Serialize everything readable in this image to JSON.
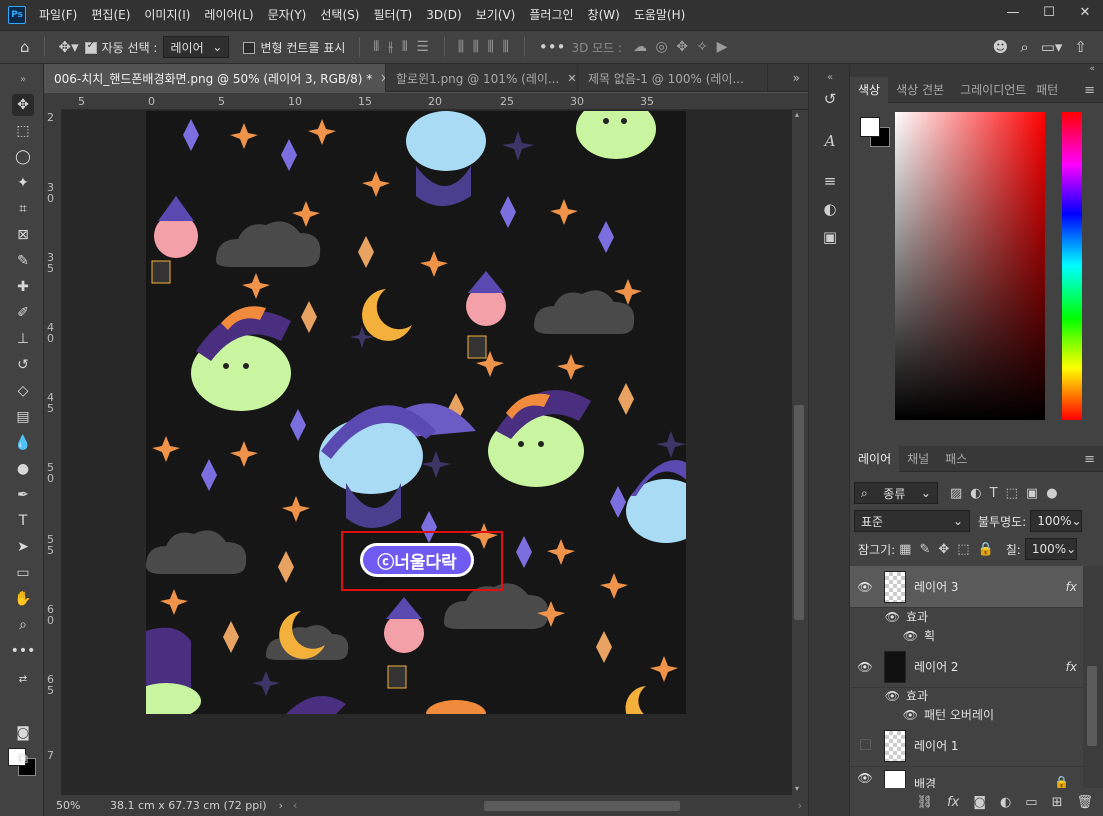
{
  "menubar": {
    "logo": "Ps",
    "items": [
      "파일(F)",
      "편집(E)",
      "이미지(I)",
      "레이어(L)",
      "문자(Y)",
      "선택(S)",
      "필터(T)",
      "3D(D)",
      "보기(V)",
      "플러그인",
      "창(W)",
      "도움말(H)"
    ],
    "minimize": "—",
    "maximize": "☐",
    "close": "✕"
  },
  "options": {
    "auto_select_label": "자동 선택 :",
    "auto_select_value": "레이어",
    "transform_controls_label": "변형 컨트롤 표시",
    "mode_3d_label": "3D 모드 :"
  },
  "tabs": [
    {
      "label": "006-치치_핸드폰배경화면.png @ 50% (레이어 3, RGB/8) *"
    },
    {
      "label": "할로윈1.png @ 101% (레이..."
    },
    {
      "label": "제목 없음-1 @ 100% (레이..."
    }
  ],
  "ruler": {
    "top": [
      "5",
      "0",
      "5",
      "10",
      "15",
      "20",
      "25",
      "30",
      "35"
    ],
    "left": [
      "2",
      "3\n0",
      "3\n5",
      "4\n0",
      "4\n5",
      "5\n0",
      "5\n5",
      "6\n0",
      "6\n5",
      "7"
    ]
  },
  "canvas": {
    "watermark_text": "ⓒ너울다락",
    "highlight_color": "#e01010"
  },
  "status": {
    "zoom": "50%",
    "doc_size": "38.1 cm x 67.73 cm (72 ppi)"
  },
  "color_panel": {
    "tabs": [
      "색상",
      "색상 견본",
      "그레이디언트",
      "패턴"
    ]
  },
  "layers_panel": {
    "tabs": [
      "레이어",
      "채널",
      "패스"
    ],
    "filter_kind": "종류",
    "blend_mode": "표준",
    "opacity_label": "불투명도:",
    "opacity_value": "100%",
    "lock_label": "잠그기:",
    "fill_label": "칠:",
    "fill_value": "100%",
    "layers": [
      {
        "name": "레이어 3",
        "fx": "fx",
        "effects_label": "효과",
        "effect": "획"
      },
      {
        "name": "레이어 2",
        "fx": "fx",
        "effects_label": "효과",
        "effect": "패턴 오버레이"
      },
      {
        "name": "레이어 1"
      },
      {
        "name": "배경"
      }
    ]
  }
}
